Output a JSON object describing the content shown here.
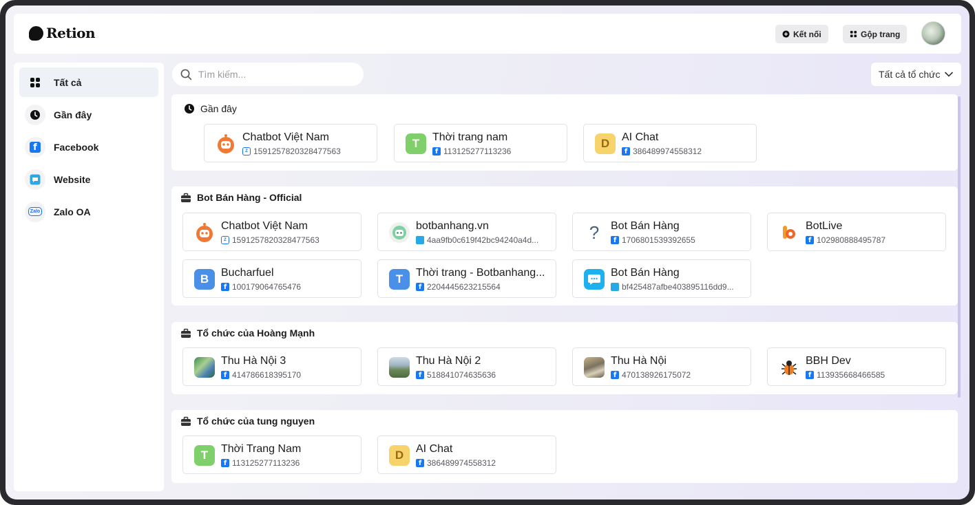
{
  "header": {
    "logo_text": "Retion",
    "connect_label": "Kết nối",
    "merge_label": "Gộp trang"
  },
  "sidebar": {
    "items": [
      {
        "label": "Tất cả",
        "icon": "grid-icon",
        "active": true
      },
      {
        "label": "Gần đây",
        "icon": "clock-icon"
      },
      {
        "label": "Facebook",
        "icon": "facebook-icon"
      },
      {
        "label": "Website",
        "icon": "website-chat-icon"
      },
      {
        "label": "Zalo OA",
        "icon": "zalo-icon"
      }
    ]
  },
  "search": {
    "placeholder": "Tìm kiếm..."
  },
  "org_filter": {
    "selected": "Tất cả tổ chức"
  },
  "sections": [
    {
      "title": "Gần đây",
      "icon": "clock-icon",
      "cards": [
        {
          "name": "Chatbot Việt Nam",
          "id": "1591257820328477563",
          "platform": "zalo",
          "icon": "robot-icon"
        },
        {
          "name": "Thời trang nam",
          "id": "113125277113236",
          "platform": "facebook",
          "letter": "T",
          "color": "#7fcf6a"
        },
        {
          "name": "AI Chat",
          "id": "386489974558312",
          "platform": "facebook",
          "letter": "D",
          "color": "#f6d36b"
        }
      ]
    },
    {
      "title": "Bot Bán Hàng - Official",
      "icon": "briefcase-icon",
      "cards": [
        {
          "name": "Chatbot Việt Nam",
          "id": "1591257820328477563",
          "platform": "zalo",
          "icon": "robot-icon"
        },
        {
          "name": "botbanhang.vn",
          "id": "4aa9fb0c619f42bc94240a4d...",
          "platform": "website",
          "icon": "green-robot-icon"
        },
        {
          "name": "Bot Bán Hàng",
          "id": "1706801539392655",
          "platform": "facebook",
          "icon": "question-icon"
        },
        {
          "name": "BotLive",
          "id": "102980888495787",
          "platform": "facebook",
          "icon": "botlive-icon"
        },
        {
          "name": "Bucharfuel",
          "id": "100179064765476",
          "platform": "facebook",
          "letter": "B",
          "color": "#4a8fe8"
        },
        {
          "name": "Thời trang - Botbanhang...",
          "id": "2204445623215564",
          "platform": "facebook",
          "letter": "T",
          "color": "#4a8fe8"
        },
        {
          "name": "Bot Bán Hàng",
          "id": "bf425487afbe403895116dd9...",
          "platform": "website",
          "icon": "chat-bubble-icon"
        }
      ]
    },
    {
      "title": "Tổ chức của Hoàng Mạnh",
      "icon": "briefcase-icon",
      "cards": [
        {
          "name": "Thu Hà Nội 3",
          "id": "414786618395170",
          "platform": "facebook",
          "icon": "landscape-photo-icon"
        },
        {
          "name": "Thu Hà Nội 2",
          "id": "518841074635636",
          "platform": "facebook",
          "icon": "lake-photo-icon"
        },
        {
          "name": "Thu Hà Nội",
          "id": "470138926175072",
          "platform": "facebook",
          "icon": "street-photo-icon"
        },
        {
          "name": "BBH Dev",
          "id": "113935668466585",
          "platform": "facebook",
          "icon": "bug-icon"
        }
      ]
    },
    {
      "title": "Tổ chức của tung nguyen",
      "icon": "briefcase-icon",
      "cards": [
        {
          "name": "Thời Trang Nam",
          "id": "113125277113236",
          "platform": "facebook",
          "letter": "T",
          "color": "#7fcf6a"
        },
        {
          "name": "AI Chat",
          "id": "386489974558312",
          "platform": "facebook",
          "letter": "D",
          "color": "#f6d36b"
        }
      ]
    }
  ]
}
